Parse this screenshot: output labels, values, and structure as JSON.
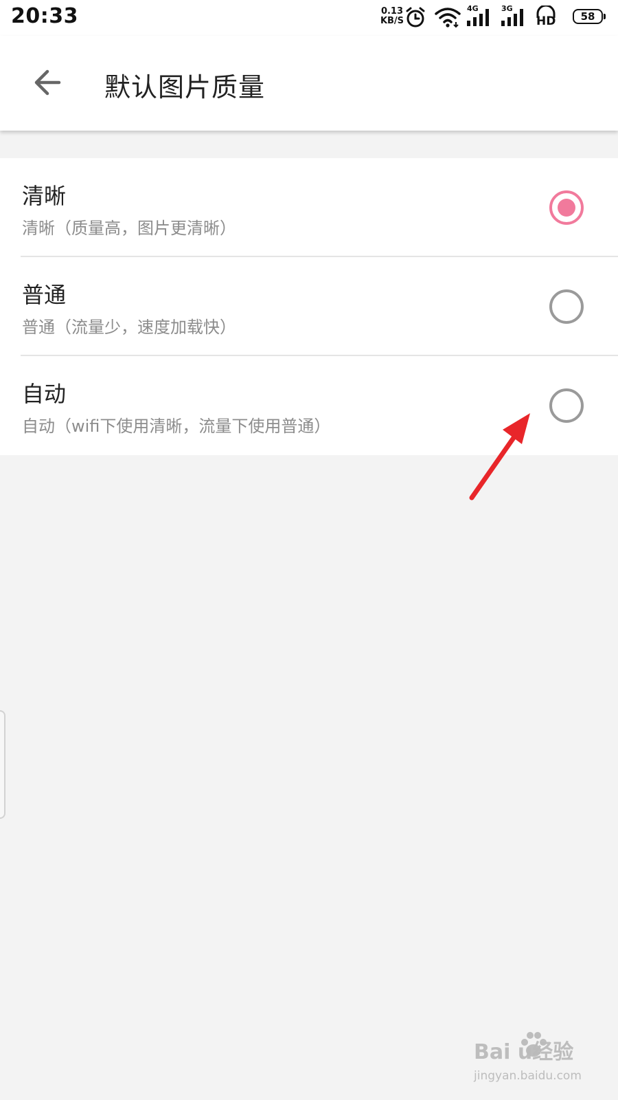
{
  "status_bar": {
    "time": "20:33",
    "net_speed_value": "0.13",
    "net_speed_unit": "KB/S",
    "signal_1_label": "4G",
    "signal_2_label": "3G",
    "hd_label": "HD",
    "battery_level": "58",
    "icons": [
      "alarm-icon",
      "wifi-icon",
      "signal-icon",
      "signal-icon",
      "hd-headset-icon",
      "battery-icon"
    ]
  },
  "app_bar": {
    "back_icon": "arrow-left-icon",
    "title": "默认图片质量"
  },
  "options": [
    {
      "title": "清晰",
      "desc": "清晰（质量高，图片更清晰）",
      "selected": true
    },
    {
      "title": "普通",
      "desc": "普通（流量少，速度加载快）",
      "selected": false
    },
    {
      "title": "自动",
      "desc": "自动（wifi下使用清晰，流量下使用普通）",
      "selected": false
    }
  ],
  "colors": {
    "accent": "#f17a9c",
    "radio_off": "#9a9a9a",
    "annotation_arrow": "#e8262a",
    "background": "#f3f3f3"
  },
  "watermark": {
    "brand": "Bai  u经验",
    "url": "jingyan.baidu.com"
  }
}
